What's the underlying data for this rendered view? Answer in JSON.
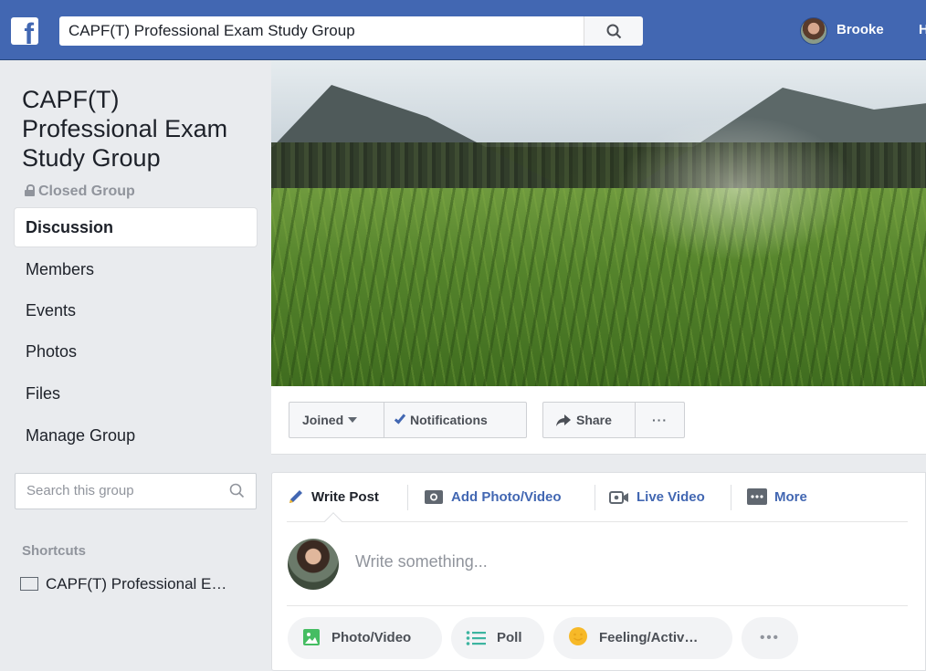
{
  "topbar": {
    "logo": "f",
    "search_value": "CAPF(T) Professional Exam Study Group",
    "user_name": "Brooke",
    "home_partial": "H"
  },
  "group": {
    "title": "CAPF(T) Professional Exam Study Group",
    "privacy": "Closed Group"
  },
  "sidebar": {
    "items": [
      {
        "label": "Discussion",
        "active": true
      },
      {
        "label": "Members"
      },
      {
        "label": "Events"
      },
      {
        "label": "Photos"
      },
      {
        "label": "Files"
      },
      {
        "label": "Manage Group"
      }
    ],
    "search_placeholder": "Search this group",
    "shortcuts_title": "Shortcuts",
    "shortcut_item": "CAPF(T) Professional E…"
  },
  "actions": {
    "joined": "Joined",
    "notifications": "Notifications",
    "share": "Share",
    "more": "···"
  },
  "composer": {
    "tabs": {
      "write": "Write Post",
      "photo": "Add Photo/Video",
      "live": "Live Video",
      "more": "More"
    },
    "placeholder": "Write something...",
    "pills": {
      "photo": "Photo/Video",
      "poll": "Poll",
      "feeling": "Feeling/Activ…",
      "more": "•••"
    }
  },
  "colors": {
    "brand": "#4267b2",
    "background": "#e9ebee"
  }
}
